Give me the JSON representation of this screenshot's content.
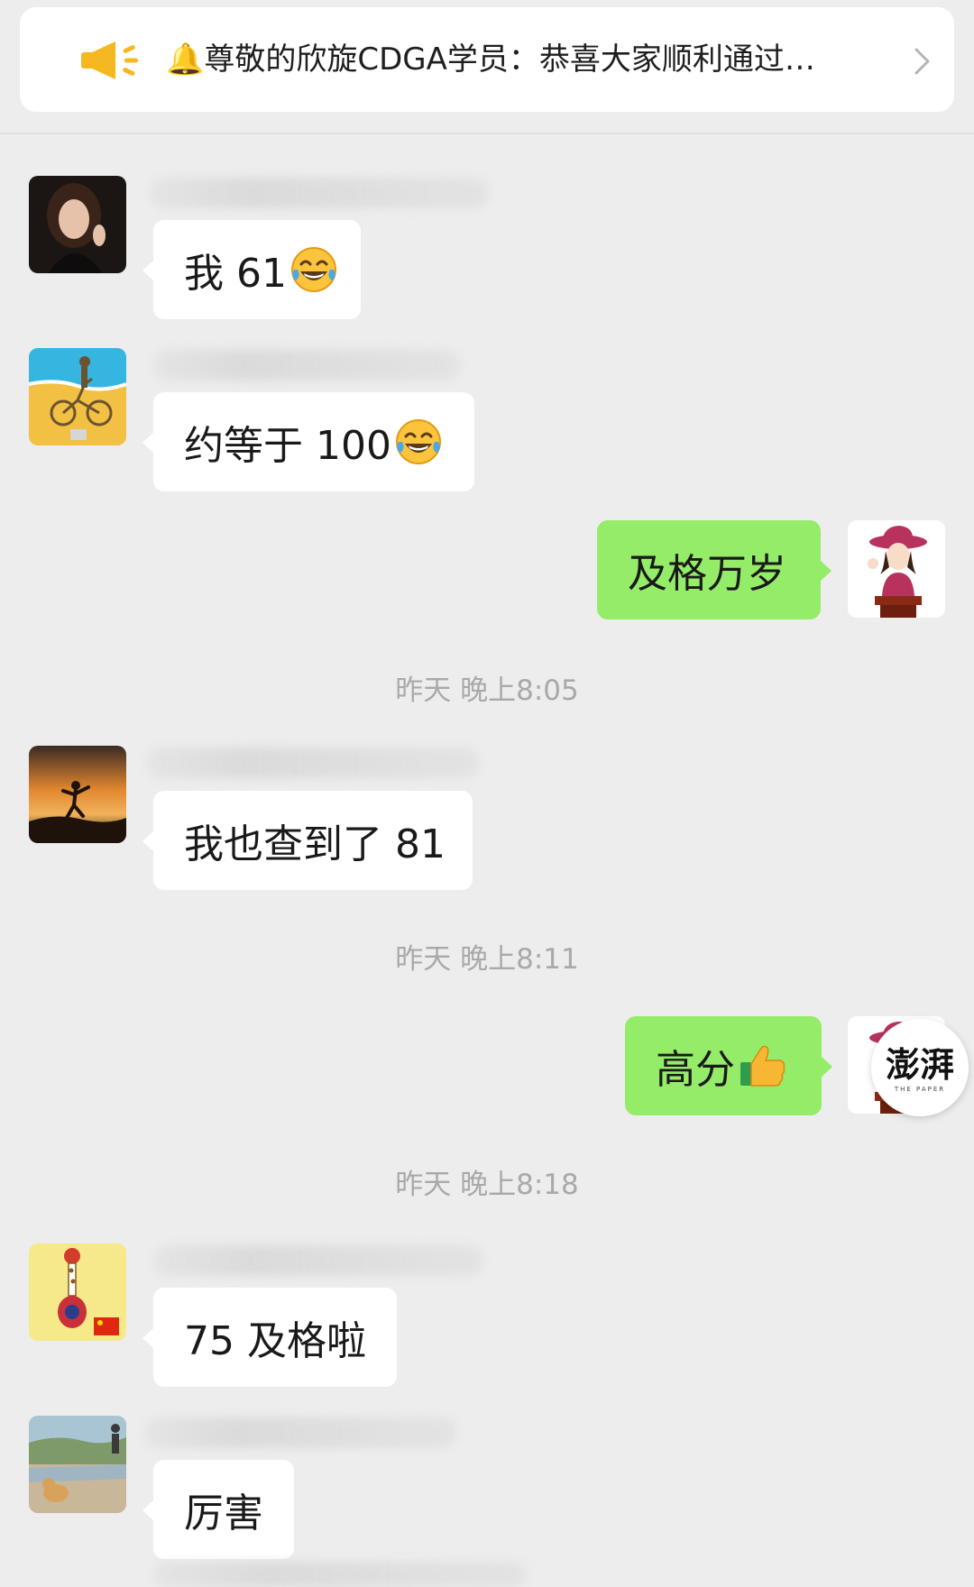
{
  "banner": {
    "text": "🔔尊敬的欣旋CDGA学员：恭喜大家顺利通过…",
    "icon": "speaker-icon",
    "chevron_icon": "chevron-right-icon"
  },
  "messages": [
    {
      "side": "in",
      "text": "我 61",
      "emoji": "tears-of-joy",
      "avatar": "woman-portrait"
    },
    {
      "side": "in",
      "text": "约等于 100",
      "emoji": "tears-of-joy",
      "avatar": "bicycle-beach"
    },
    {
      "side": "out",
      "text": "及格万岁",
      "avatar": "cartoon-hat-woman"
    },
    {
      "side": "in",
      "text": "我也查到了 81",
      "avatar": "sunset-runner"
    },
    {
      "side": "out",
      "text": "高分",
      "emoji": "thumbs-up",
      "avatar": "cartoon-hat-woman"
    },
    {
      "side": "in",
      "text": "75 及格啦",
      "avatar": "cartoon-figure"
    },
    {
      "side": "in",
      "text": "厉害",
      "avatar": "dog-beach"
    }
  ],
  "timestamps": [
    "昨天 晚上8:05",
    "昨天 晚上8:11",
    "昨天 晚上8:18"
  ],
  "watermark": {
    "text": "澎湃",
    "subtext": "THE PAPER"
  },
  "colors": {
    "background": "#ededed",
    "incoming_bubble": "#ffffff",
    "outgoing_bubble": "#95ec69",
    "timestamp": "#a9a9a9",
    "speaker": "#f5b820"
  }
}
